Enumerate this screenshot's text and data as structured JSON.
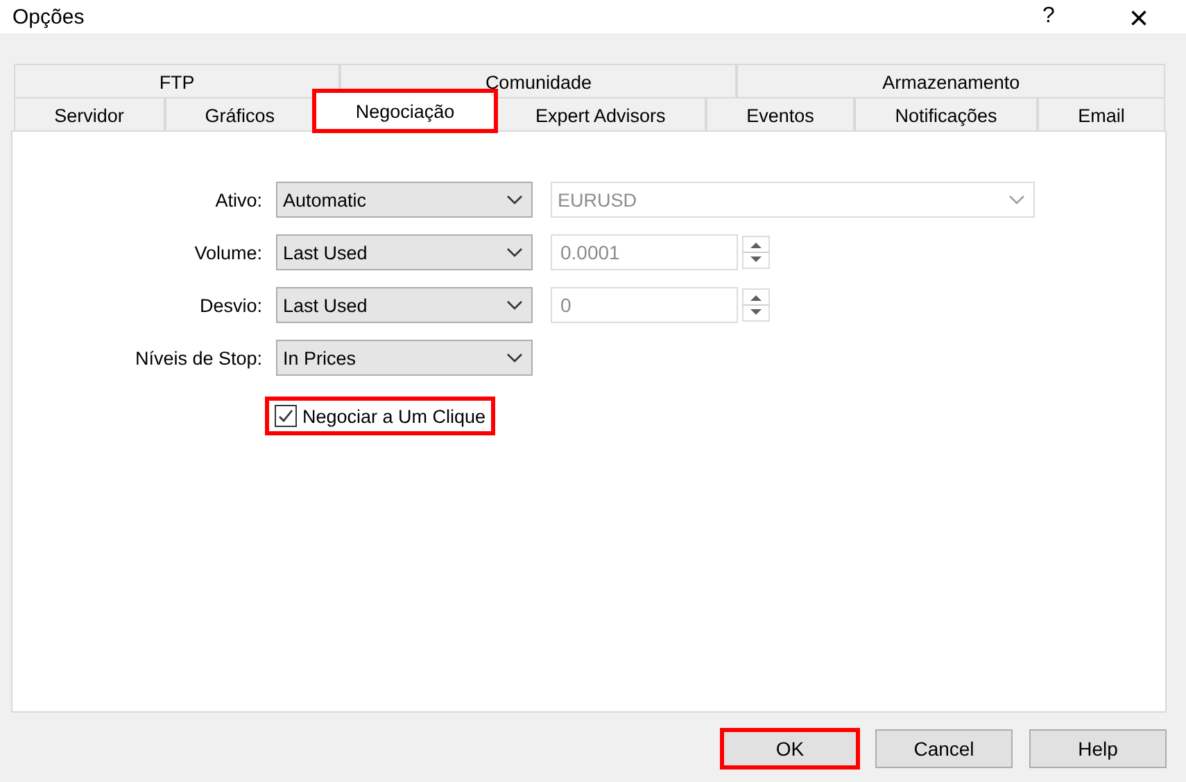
{
  "window": {
    "title": "Opções",
    "help": "?",
    "close": "×"
  },
  "tab_rows": [
    {
      "tabs": [
        {
          "label": "FTP",
          "selected": false,
          "highlighted": false
        },
        {
          "label": "Comunidade",
          "selected": false,
          "highlighted": false
        },
        {
          "label": "Armazenamento",
          "selected": false,
          "highlighted": false
        }
      ]
    },
    {
      "tabs": [
        {
          "label": "Servidor",
          "selected": false,
          "highlighted": false
        },
        {
          "label": "Gráficos",
          "selected": false,
          "highlighted": false
        },
        {
          "label": "Negociação",
          "selected": true,
          "highlighted": true
        },
        {
          "label": "Expert Advisors",
          "selected": false,
          "highlighted": false
        },
        {
          "label": "Eventos",
          "selected": false,
          "highlighted": false
        },
        {
          "label": "Notificações",
          "selected": false,
          "highlighted": false
        },
        {
          "label": "Email",
          "selected": false,
          "highlighted": false
        }
      ]
    }
  ],
  "fields": [
    {
      "label": "Ativo:",
      "select": "Automatic",
      "extra": {
        "kind": "combo",
        "value": "EURUSD",
        "disabled": true
      }
    },
    {
      "label": "Volume:",
      "select": "Last Used",
      "extra": {
        "kind": "spin",
        "value": "0.0001",
        "disabled": true
      }
    },
    {
      "label": "Desvio:",
      "select": "Last Used",
      "extra": {
        "kind": "spin",
        "value": "0",
        "disabled": true
      }
    },
    {
      "label": "Níveis de Stop:",
      "select": "In Prices"
    }
  ],
  "checkbox": {
    "label": "Negociar a Um Clique",
    "checked": true,
    "highlighted": true
  },
  "buttons": [
    {
      "label": "OK",
      "highlighted": true
    },
    {
      "label": "Cancel",
      "highlighted": false
    },
    {
      "label": "Help",
      "highlighted": false
    }
  ]
}
